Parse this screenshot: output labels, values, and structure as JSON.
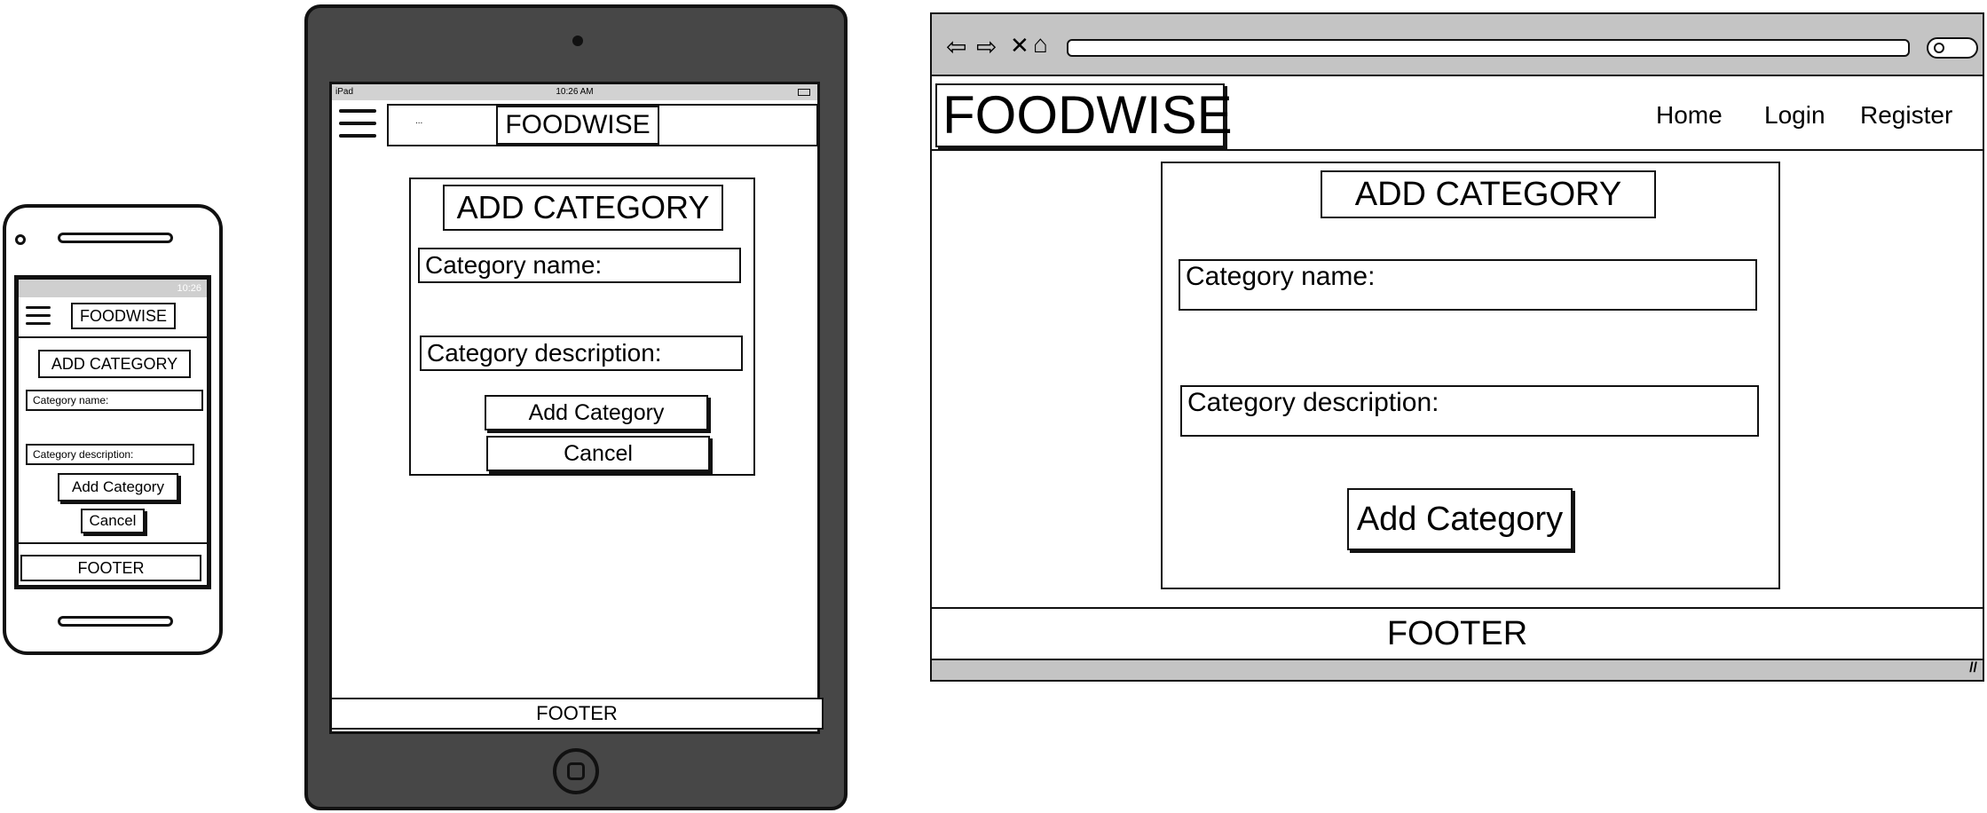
{
  "app_name": "FOODWISE",
  "form_title": "ADD CATEGORY",
  "fields": {
    "name_label": "Category name:",
    "description_label": "Category description:"
  },
  "buttons": {
    "add": "Add Category",
    "cancel": "Cancel"
  },
  "footer": "FOOTER",
  "nav": {
    "items": [
      "Home",
      "Login",
      "Register"
    ]
  },
  "tablet": {
    "status_device": "iPad",
    "status_time": "10:26 AM",
    "search_text": "..."
  },
  "phone": {
    "status_time": "10:26"
  },
  "colors": {
    "device_dark": "#474747",
    "chrome_gray": "#c4c4c4",
    "ink": "#111111"
  }
}
